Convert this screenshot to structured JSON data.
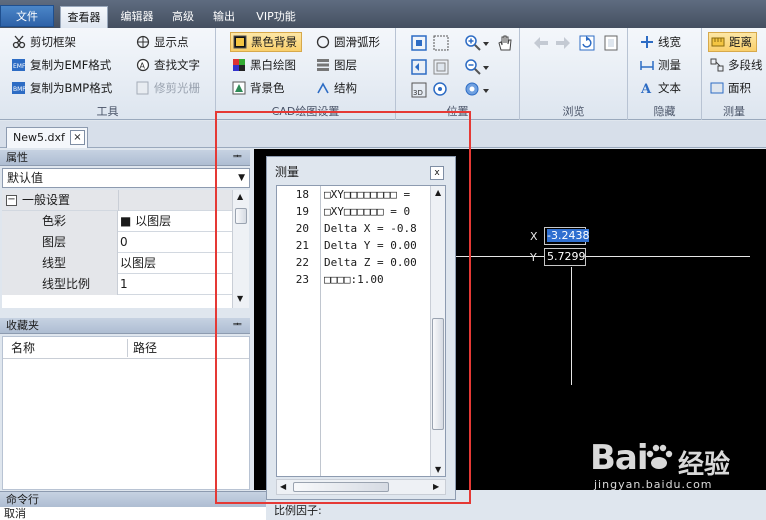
{
  "tabs": [
    {
      "label": "文件"
    },
    {
      "label": "查看器"
    },
    {
      "label": "编辑器"
    },
    {
      "label": "高级"
    },
    {
      "label": "输出"
    },
    {
      "label": "VIP功能"
    }
  ],
  "ribbon": {
    "tools": {
      "label": "工具",
      "items": [
        "剪切框架",
        "复制为EMF格式",
        "复制为BMP格式"
      ],
      "items2": [
        "显示点",
        "查找文字",
        "修剪光栅"
      ]
    },
    "cad": {
      "label": "CAD绘图设置",
      "items": [
        "黑色背景",
        "黑白绘图",
        "背景色"
      ],
      "items2": [
        "圆滑弧形",
        "图层",
        "结构"
      ]
    },
    "position": {
      "label": "位置"
    },
    "browse": {
      "label": "浏览"
    },
    "hide": {
      "label": "隐藏",
      "items": [
        "线宽",
        "测量",
        "文本"
      ]
    },
    "measure": {
      "label": "测量",
      "items": [
        "距离",
        "多段线",
        "面积"
      ]
    }
  },
  "document": {
    "tab_name": "New5.dxf",
    "close": "×"
  },
  "properties": {
    "title": "属性",
    "pin": "ᆂ",
    "selector": "默认值",
    "group": "一般设置",
    "rows": [
      {
        "key": "色彩",
        "value": "■ 以图层"
      },
      {
        "key": "图层",
        "value": "0"
      },
      {
        "key": "线型",
        "value": "以图层"
      },
      {
        "key": "线型比例",
        "value": "1"
      }
    ]
  },
  "favorites": {
    "title": "收藏夹",
    "col_name": "名称",
    "col_path": "路径"
  },
  "canvas": {
    "x_label": "X",
    "x_value": "-3.2438",
    "y_label": "Y",
    "y_value": "5.7299"
  },
  "measure_dialog": {
    "title": "测量",
    "close": "x",
    "lines": [
      {
        "n": "18",
        "text": "□XY□□□□□□□□ = "
      },
      {
        "n": "19",
        "text": "□XY□□□□□□ = 0"
      },
      {
        "n": "20",
        "text": "Delta X = -0.8"
      },
      {
        "n": "21",
        "text": "Delta Y = 0.00"
      },
      {
        "n": "22",
        "text": "Delta Z = 0.00"
      },
      {
        "n": "23",
        "text": "□□□□:1.00"
      }
    ],
    "factor_label": "比例因子:"
  },
  "command": {
    "title": "命令行",
    "text": "取消"
  },
  "watermark": {
    "brand": "Bai",
    "brand2": "经验",
    "site": "jingyan.baidu.com"
  }
}
